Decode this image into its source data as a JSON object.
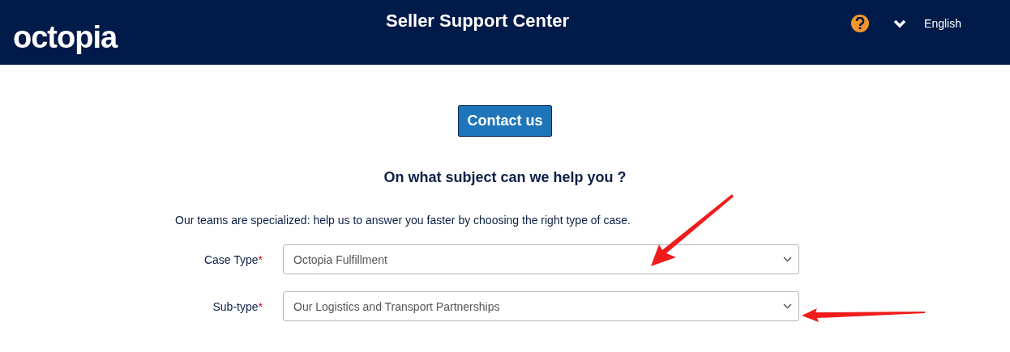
{
  "header": {
    "logo": "octopia",
    "title": "Seller Support Center",
    "language": "English"
  },
  "contact_button": "Contact us",
  "heading": "On what subject can we help you ?",
  "intro": "Our teams are specialized: help us to answer you faster by choosing the right type of case.",
  "fields": [
    {
      "label": "Case Type",
      "required_mark": "*",
      "value": "Octopia Fulfillment"
    },
    {
      "label": "Sub-type",
      "required_mark": "*",
      "value": "Our Logistics and Transport Partnerships"
    }
  ]
}
